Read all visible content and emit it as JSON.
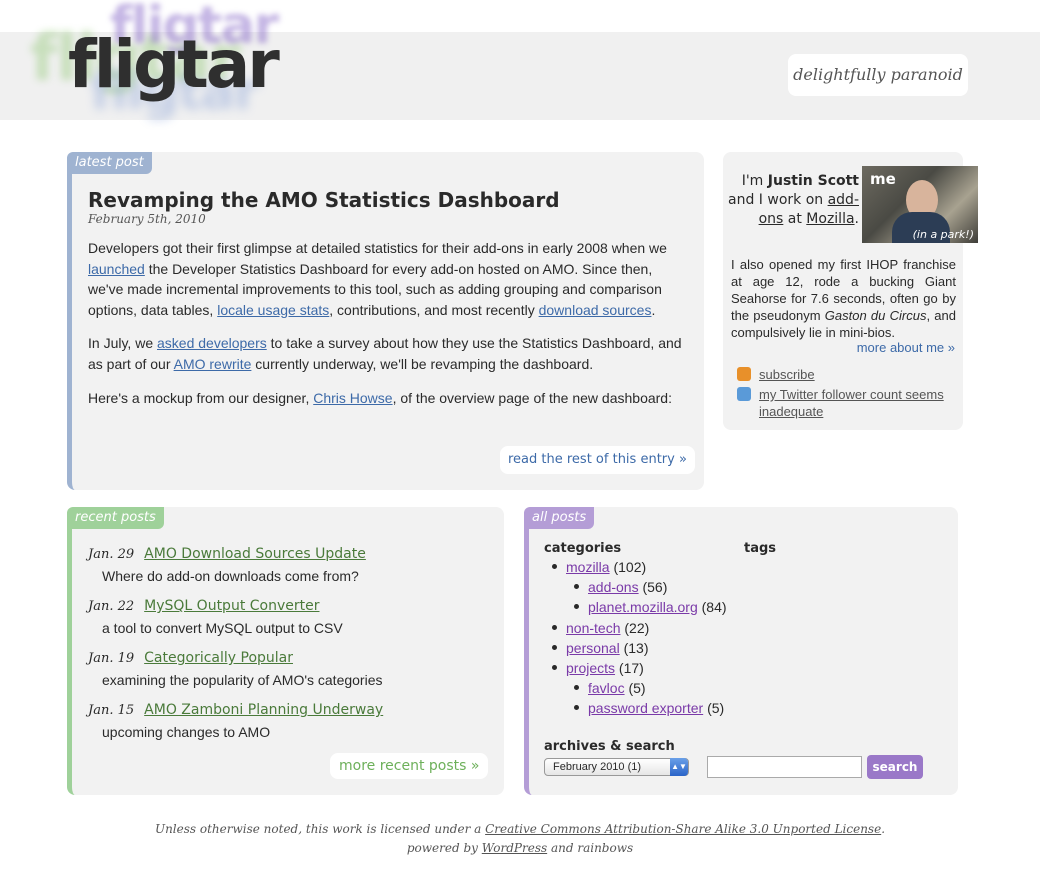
{
  "site": {
    "logo": "fligtar",
    "tagline": "delightfully paranoid"
  },
  "latest": {
    "tab": "latest post",
    "title": "Revamping the AMO Statistics Dashboard",
    "date": "February 5th, 2010",
    "p1_a": "Developers got their first glimpse at detailed statistics for their add-ons in early 2008 when we",
    "p1_link1": "launched",
    "p1_b": " the Developer Statistics Dashboard for every add-on hosted on AMO. Since then, we've made incremental improvements to this tool, such as adding grouping and comparison options, data tables, ",
    "p1_link2": "locale usage stats",
    "p1_c": ", contributions, and most recently ",
    "p1_link3": "download sources",
    "p1_d": ".",
    "p2_a": "In July, we ",
    "p2_link1": "asked developers",
    "p2_b": " to take a survey about how they use the Statistics Dashboard, and as part of our ",
    "p2_link2": "AMO rewrite",
    "p2_c": " currently underway, we'll be revamping the dashboard.",
    "p3_a": "Here's a mockup from our designer, ",
    "p3_link": "Chris Howse",
    "p3_b": ", of the overview page of the new dashboard:",
    "read_more": "read the rest of this entry »"
  },
  "about": {
    "intro_a": "I'm ",
    "name": "Justin Scott",
    "intro_b": " and I work on ",
    "link1": "add-ons",
    "intro_c": " at ",
    "link2": "Mozilla",
    "intro_d": ".",
    "photo_me": "me",
    "photo_caption": "(in a park!)",
    "bio_a": "I also opened my first IHOP franchise at age 12, rode a bucking Giant Seahorse for 7.6 seconds, often go by the pseudonym ",
    "bio_em": "Gaston du Circus",
    "bio_b": ", and compulsively lie in mini-bios.",
    "more": "more about me »",
    "subscribe": "subscribe",
    "twitter": "my Twitter follower count seems inadequate"
  },
  "recent": {
    "tab": "recent posts",
    "items": [
      {
        "date": "Jan. 29",
        "title": "AMO Download Sources Update",
        "sub": "Where do add-on downloads come from?"
      },
      {
        "date": "Jan. 22",
        "title": "MySQL Output Converter",
        "sub": "a tool to convert MySQL output to CSV"
      },
      {
        "date": "Jan. 19",
        "title": "Categorically Popular",
        "sub": "examining the popularity of AMO's categories"
      },
      {
        "date": "Jan. 15",
        "title": "AMO Zamboni Planning Underway",
        "sub": "upcoming changes to AMO"
      }
    ],
    "more": "more recent posts »"
  },
  "all": {
    "tab": "all posts",
    "categories_title": "categories",
    "cats": [
      {
        "name": "mozilla",
        "count": "(102)"
      },
      {
        "name": "add-ons",
        "count": "(56)"
      },
      {
        "name": "planet.mozilla.org",
        "count": "(84)"
      },
      {
        "name": "non-tech",
        "count": "(22)"
      },
      {
        "name": "personal",
        "count": "(13)"
      },
      {
        "name": "projects",
        "count": "(17)"
      },
      {
        "name": "favloc",
        "count": "(5)"
      },
      {
        "name": "password exporter",
        "count": "(5)"
      }
    ],
    "tags_title": "tags",
    "archives_title": "archives & search",
    "archive_selected": "February 2010  (1)",
    "search_button": "search"
  },
  "footer": {
    "line1_a": "Unless otherwise noted, this work is licensed under a ",
    "line1_link": "Creative Commons Attribution-Share Alike 3.0 Unported License",
    "line1_b": ".",
    "line2_a": "powered by ",
    "line2_link": "WordPress",
    "line2_b": " and rainbows"
  },
  "colors": {
    "accent_blue": "#9fb3d1",
    "accent_green": "#9fd19a",
    "accent_purple": "#b49dd6",
    "link_purple": "#7a3aa8"
  }
}
